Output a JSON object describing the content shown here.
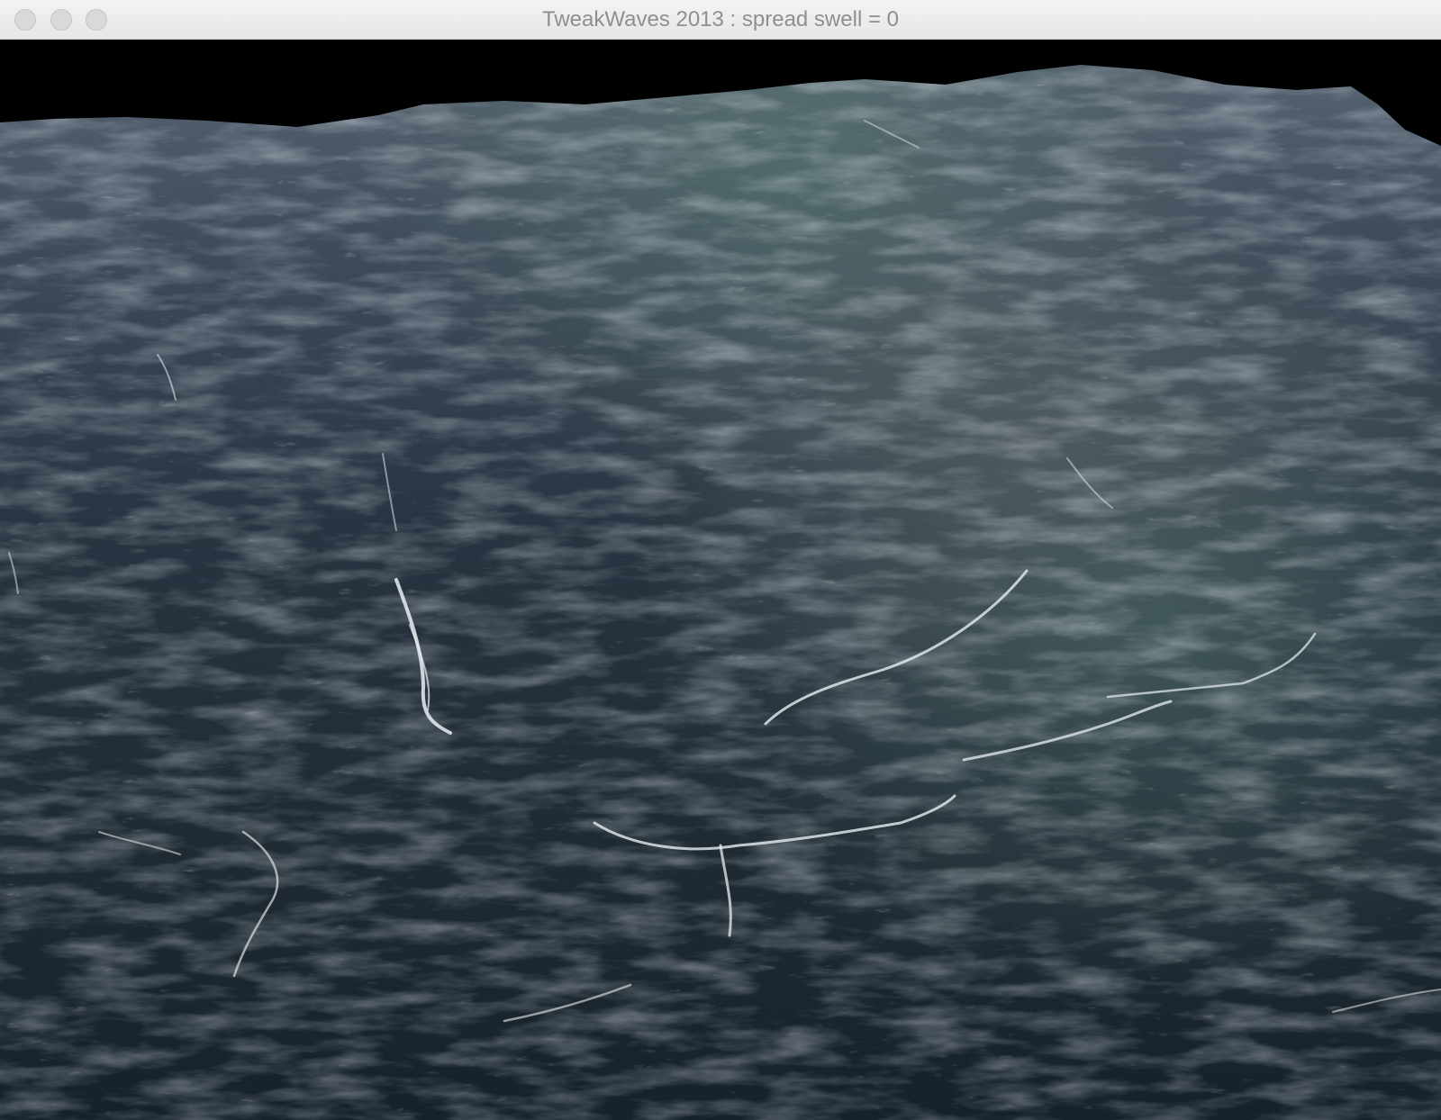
{
  "window": {
    "title": "TweakWaves 2013 : spread swell = 0",
    "buttons": {
      "close": "close-button",
      "minimize": "minimize-button",
      "zoom": "zoom-button"
    }
  },
  "viewport": {
    "scene": "ocean-surface-render",
    "sky_color": "#000000",
    "water_colors": {
      "deep": "#1b2530",
      "mid": "#3a4857",
      "highlight": "#7f8c99",
      "green_tint": "#3e5a58",
      "foam": "#e8eef2"
    }
  }
}
